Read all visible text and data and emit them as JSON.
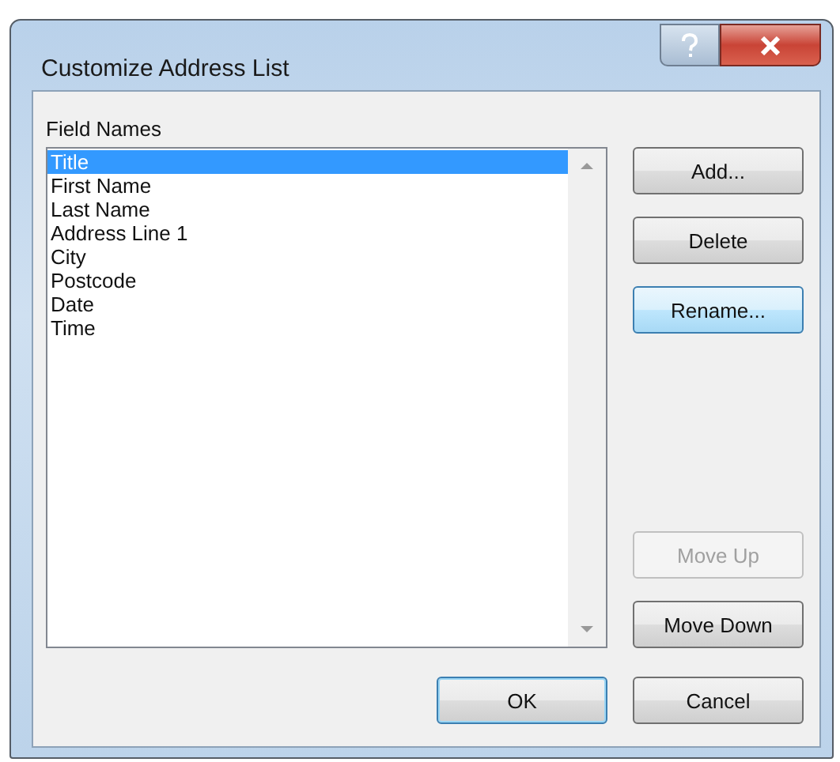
{
  "window": {
    "title": "Customize Address List"
  },
  "field_names": {
    "label": "Field Names",
    "items": [
      {
        "label": "Title",
        "selected": true
      },
      {
        "label": "First Name",
        "selected": false
      },
      {
        "label": "Last Name",
        "selected": false
      },
      {
        "label": "Address Line 1",
        "selected": false
      },
      {
        "label": "City",
        "selected": false
      },
      {
        "label": "Postcode",
        "selected": false
      },
      {
        "label": "Date",
        "selected": false
      },
      {
        "label": "Time",
        "selected": false
      }
    ]
  },
  "side_buttons": [
    {
      "label": "Add...",
      "disabled": false,
      "focused": false
    },
    {
      "label": "Delete",
      "disabled": false,
      "focused": false
    },
    {
      "label": "Rename...",
      "disabled": false,
      "focused": true
    },
    {
      "label": "Move Up",
      "disabled": true,
      "focused": false
    },
    {
      "label": "Move Down",
      "disabled": false,
      "focused": false
    }
  ],
  "buttons": [
    {
      "label": "OK",
      "default": true
    },
    {
      "label": "Cancel",
      "default": false
    }
  ]
}
